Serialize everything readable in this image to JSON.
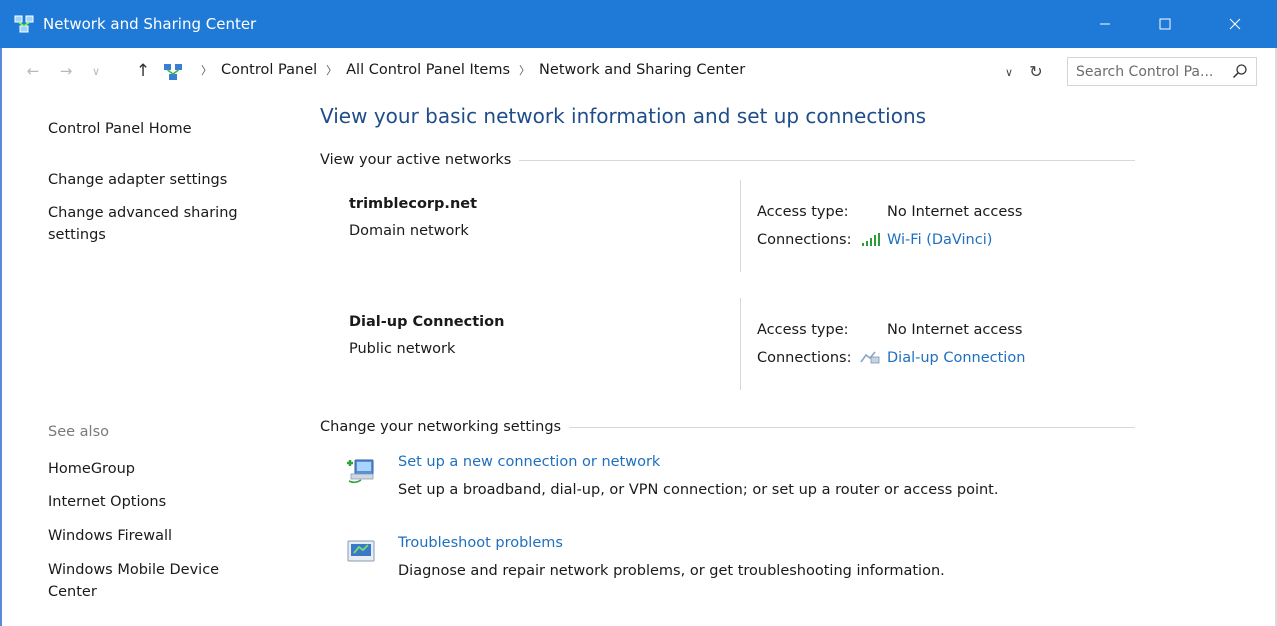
{
  "window": {
    "title": "Network and Sharing Center",
    "accent": "#1e7ad6",
    "link_color": "#1f6fbf",
    "heading_color": "#1f4d8a"
  },
  "titlebar_buttons": {
    "minimize_icon": "minimize-icon",
    "maximize_icon": "maximize-icon",
    "close_icon": "close-icon"
  },
  "address": {
    "crumbs": [
      "Control Panel",
      "All Control Panel Items",
      "Network and Sharing Center"
    ],
    "search_placeholder": "Search Control Pa..."
  },
  "left_pane": {
    "home": "Control Panel Home",
    "links": [
      "Change adapter settings",
      "Change advanced sharing settings"
    ],
    "see_also_label": "See also",
    "see_also": [
      "HomeGroup",
      "Internet Options",
      "Windows Firewall",
      "Windows Mobile Device Center"
    ]
  },
  "main": {
    "title": "View your basic network information and set up connections",
    "active_networks_label": "View your active networks",
    "networks": [
      {
        "name": "trimblecorp.net",
        "kind": "Domain network",
        "access_label": "Access type:",
        "access_value": "No Internet access",
        "connections_label": "Connections:",
        "connection": "Wi-Fi (DaVinci)",
        "connection_icon": "wifi-signal-icon"
      },
      {
        "name": "Dial-up Connection",
        "kind": "Public network",
        "access_label": "Access type:",
        "access_value": "No Internet access",
        "connections_label": "Connections:",
        "connection": "Dial-up Connection",
        "connection_icon": "dialup-icon"
      }
    ],
    "change_settings_label": "Change your networking settings",
    "tasks": [
      {
        "link": "Set up a new connection or network",
        "desc": "Set up a broadband, dial-up, or VPN connection; or set up a router or access point.",
        "icon": "new-connection-icon"
      },
      {
        "link": "Troubleshoot problems",
        "desc": "Diagnose and repair network problems, or get troubleshooting information.",
        "icon": "troubleshoot-icon"
      }
    ]
  }
}
